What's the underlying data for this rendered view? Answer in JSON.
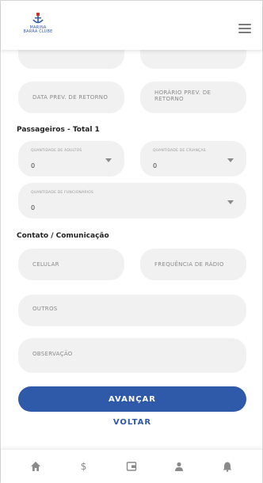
{
  "brand": {
    "logo_text_line1": "MARINA",
    "logo_text_line2": "BARRA CLUBE"
  },
  "form": {
    "return_date_label": "DATA PREV. DE RETORNO",
    "return_time_label": "HORÁRIO PREV. DE RETORNO",
    "passengers_title": "Passageiros - Total 1",
    "adults": {
      "label": "QUANTIDADE DE ADULTOS",
      "value": "0"
    },
    "children": {
      "label": "QUANTIDADE DE CRIANÇAS",
      "value": "0"
    },
    "staff": {
      "label": "QUANTIDADE DE FUNCIONÁRIOS",
      "value": "0"
    },
    "contact_title": "Contato / Comunicação",
    "phone_label": "CELULAR",
    "radio_label": "FREQUÊNCIA DE RÁDIO",
    "others_label": "OUTROS",
    "notes_label": "OBSERVAÇÃO"
  },
  "actions": {
    "next_label": "AVANÇAR",
    "back_label": "VOLTAR"
  },
  "nav": {
    "items": [
      {
        "icon": "home-icon"
      },
      {
        "icon": "dollar-icon",
        "glyph": "$"
      },
      {
        "icon": "wallet-icon"
      },
      {
        "icon": "user-icon"
      },
      {
        "icon": "bell-icon"
      }
    ]
  },
  "colors": {
    "accent": "#2f59a9",
    "field_bg": "#f1f1f1",
    "text_muted": "#8a8a8a"
  }
}
